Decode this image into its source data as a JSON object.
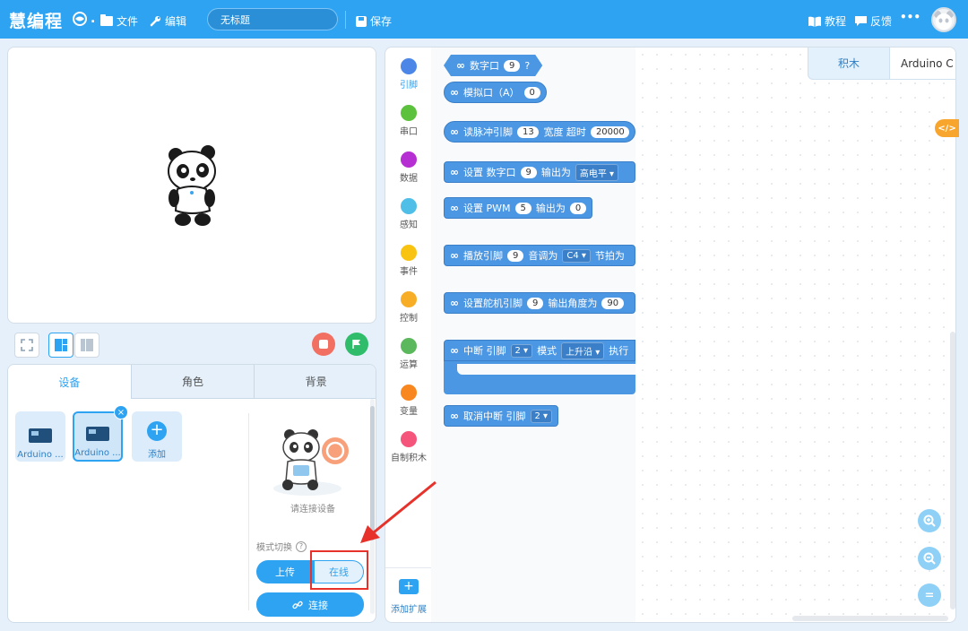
{
  "topbar": {
    "logo": "慧编程",
    "globe_suffix": ".",
    "file_label": "文件",
    "edit_label": "编辑",
    "project_title": "无标题",
    "save_label": "保存",
    "tutorial_label": "教程",
    "feedback_label": "反馈",
    "more_label": "•••"
  },
  "device_panel": {
    "tabs": [
      "设备",
      "角色",
      "背景"
    ],
    "devices": [
      {
        "label": "Arduino ..."
      },
      {
        "label": "Arduino ..."
      }
    ],
    "add_label": "添加",
    "close_badge": "×",
    "add_plus": "+",
    "connect_hint": "请连接设备",
    "mode_switch_label": "模式切换",
    "help_glyph": "?",
    "mode_upload": "上传",
    "mode_online": "在线",
    "connect_button": "连接"
  },
  "categories": [
    {
      "label": "引脚",
      "color": "#4c87e8"
    },
    {
      "label": "串口",
      "color": "#5cc13c"
    },
    {
      "label": "数据",
      "color": "#b52fd2"
    },
    {
      "label": "感知",
      "color": "#4fbfe8"
    },
    {
      "label": "事件",
      "color": "#f9c312"
    },
    {
      "label": "控制",
      "color": "#f8ad27"
    },
    {
      "label": "运算",
      "color": "#5cb85c"
    },
    {
      "label": "变量",
      "color": "#f7871e"
    },
    {
      "label": "自制积木",
      "color": "#f5557a"
    }
  ],
  "extension_label": "添加扩展",
  "blocks": {
    "digital_read": {
      "text": "数字口",
      "value": "9",
      "suffix": "?"
    },
    "analog_read": {
      "text": "模拟口（A）",
      "value": "0"
    },
    "pulse_in": {
      "text": "读脉冲引脚",
      "pin": "13",
      "text2": "宽度 超时",
      "timeout": "20000"
    },
    "set_digital": {
      "text": "设置 数字口",
      "pin": "9",
      "text2": "输出为",
      "level": "高电平 ▾"
    },
    "set_pwm": {
      "text": "设置 PWM",
      "pin": "5",
      "text2": "输出为",
      "value": "0"
    },
    "play_tone": {
      "text": "播放引脚",
      "pin": "9",
      "text2": "音调为",
      "note": "C4 ▾",
      "text3": "节拍为"
    },
    "set_servo": {
      "text": "设置舵机引脚",
      "pin": "9",
      "text2": "输出角度为",
      "angle": "90"
    },
    "interrupt": {
      "text": "中断 引脚",
      "pin": "2 ▾",
      "text2": "模式",
      "mode": "上升沿 ▾",
      "text3": "执行"
    },
    "detach_interrupt": {
      "text": "取消中断 引脚",
      "pin": "2 ▾"
    }
  },
  "workspace": {
    "tab_blocks": "积木",
    "tab_code": "Arduino C",
    "code_toggle": "</>",
    "zoom_in": "+",
    "zoom_out": "−",
    "zoom_reset": "="
  },
  "colors": {
    "brand": "#2ea3f2",
    "block": "#4c97e3",
    "annotation": "#e6322b"
  }
}
